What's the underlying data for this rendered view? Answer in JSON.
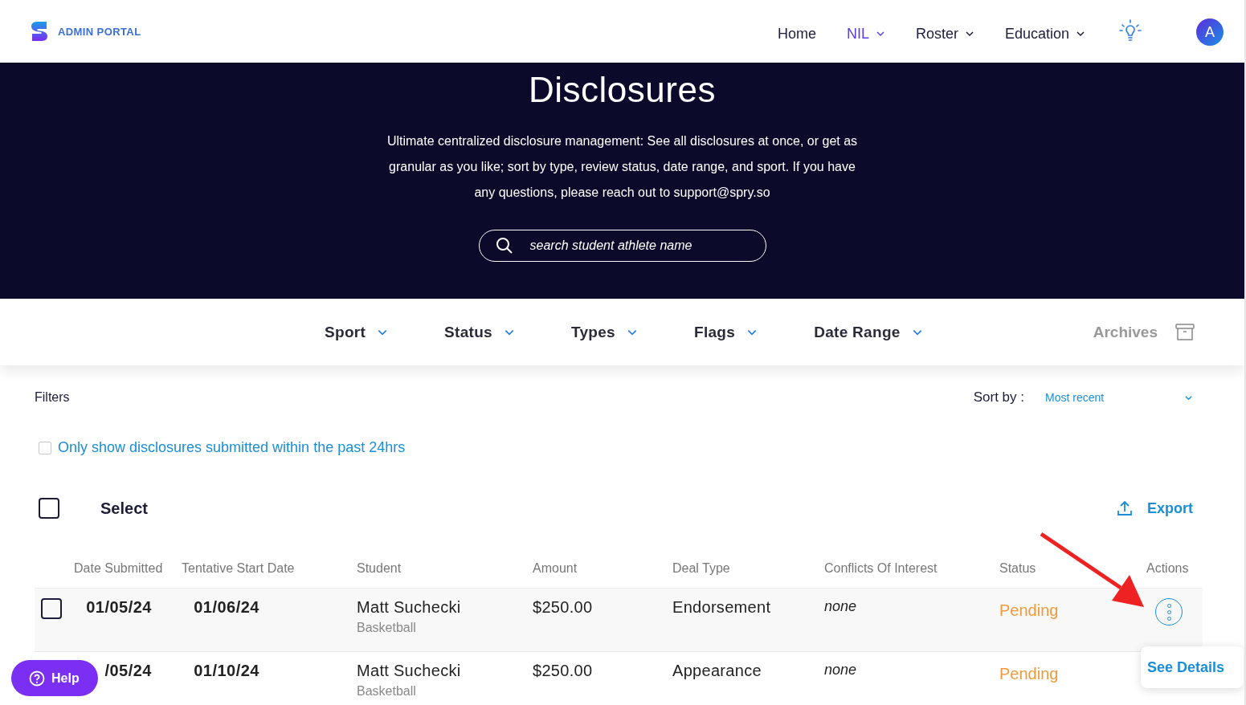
{
  "brand": {
    "name": "ADMIN PORTAL"
  },
  "nav": [
    {
      "label": "Home",
      "selected": false,
      "dropdown": false
    },
    {
      "label": "NIL",
      "selected": true,
      "dropdown": true
    },
    {
      "label": "Roster",
      "selected": false,
      "dropdown": true
    },
    {
      "label": "Education",
      "selected": false,
      "dropdown": true
    }
  ],
  "avatar": {
    "initial": "A"
  },
  "hero": {
    "title": "Disclosures",
    "description": "Ultimate centralized disclosure management: See all disclosures at once, or get as granular as you like; sort by type, review status, date range, and sport. If you have any questions, please reach out to support@spry.so",
    "search": {
      "placeholder": "search student athlete name"
    }
  },
  "filter_bar": {
    "filters": [
      "Sport",
      "Status",
      "Types",
      "Flags",
      "Date Range"
    ],
    "archives": "Archives"
  },
  "filters_label": "Filters",
  "sort": {
    "label": "Sort by :",
    "value": "Most recent"
  },
  "recent_only": {
    "label": "Only show disclosures submitted within the past 24hrs",
    "checked": false
  },
  "select": {
    "label": "Select",
    "checked": false
  },
  "export": "Export",
  "table": {
    "columns": [
      "Date Submitted",
      "Tentative Start Date",
      "Student",
      "Amount",
      "Deal Type",
      "Conflicts Of Interest",
      "Status",
      "Actions"
    ],
    "rows": [
      {
        "checked": false,
        "date_submitted": "01/05/24",
        "start_date": "01/06/24",
        "student": "Matt Suchecki",
        "sport": "Basketball",
        "amount": "$250.00",
        "deal_type": "Endorsement",
        "conflicts": "none",
        "status": "Pending"
      },
      {
        "date_submitted": "/05/24",
        "start_date": "01/10/24",
        "student": "Matt Suchecki",
        "sport": "Basketball",
        "amount": "$250.00",
        "deal_type": "Appearance",
        "conflicts": "none",
        "status": "Pending"
      }
    ]
  },
  "popover": {
    "label": "See Details"
  },
  "help": {
    "label": "Help"
  }
}
